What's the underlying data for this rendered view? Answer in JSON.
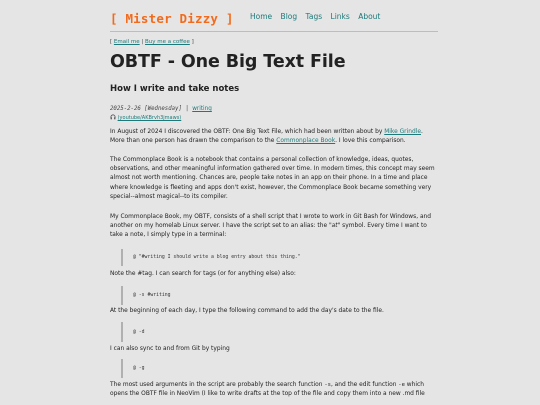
{
  "header": {
    "logo": "[ Mister Dizzy ]",
    "nav": [
      "Home",
      "Blog",
      "Tags",
      "Links",
      "About"
    ]
  },
  "links": {
    "open": "[",
    "email": "Email me",
    "sep": "|",
    "coffee": "Buy me a coffee",
    "close": "]"
  },
  "post": {
    "title": "OBTF - One Big Text File",
    "subtitle": "How I write and take notes",
    "date": "2025-2-26 [Wednesday]",
    "meta_sep": "|",
    "tag": "writing",
    "audio_label": "(youtube/AKBrvh3jmaws)",
    "p1": {
      "a": "In August of 2024 I discovered the OBTF: One Big Text File, which had been written about by ",
      "link1": "Mike Grindle",
      "b": ". More than one person has drawn the comparison to the ",
      "link2": "Commonplace Book",
      "c": ". I love this comparison."
    },
    "p2": "The Commonplace Book is a notebook that contains a personal collection of knowledge, ideas, quotes, observations, and other meaningful information gathered over time. In modern times, this concept may seem almost not worth mentioning. Chances are, people take notes in an app on their phone. In a time and place where knowledge is fleeting and apps don't exist, however, the Commonplace Book became something very special--almost magical--to its compiler.",
    "p3": {
      "a": "My Commonplace Book, my OBTF, consists of a shell script that I wrote to work in Git Bash for Windows, and another on my homelab Linux server. I have the script set to an alias: the ",
      "alias": "\"at\"",
      "b": " symbol. Every time I want to take a note, I simply type in a terminal:"
    },
    "code1": "@ \"#writing I should write a blog entry about this thing.\"",
    "p4": "Note the #tag. I can search for tags (or for anything else) also:",
    "code2": "@ -s #writing",
    "p5": "At the beginning of each day, I type the following command to add the day's date to the file.",
    "code3": "@ -d",
    "p6": "I can also sync to and from Git by typing",
    "code4": "@ -g",
    "p7": {
      "a": "The most used arguments in the script are probably the search function ",
      "flag1": "-s",
      "b": ", and the edit function ",
      "flag2": "-e",
      "c": " which opens the OBTF file in NeoVim (I like to write drafts at the top of the file and copy them into a new .md file"
    }
  },
  "colors": {
    "background": "#e5e5e5",
    "accent_orange": "#f26a1b",
    "link_teal": "#1d7a7a"
  },
  "icons": {
    "audio": "headphones-icon"
  }
}
